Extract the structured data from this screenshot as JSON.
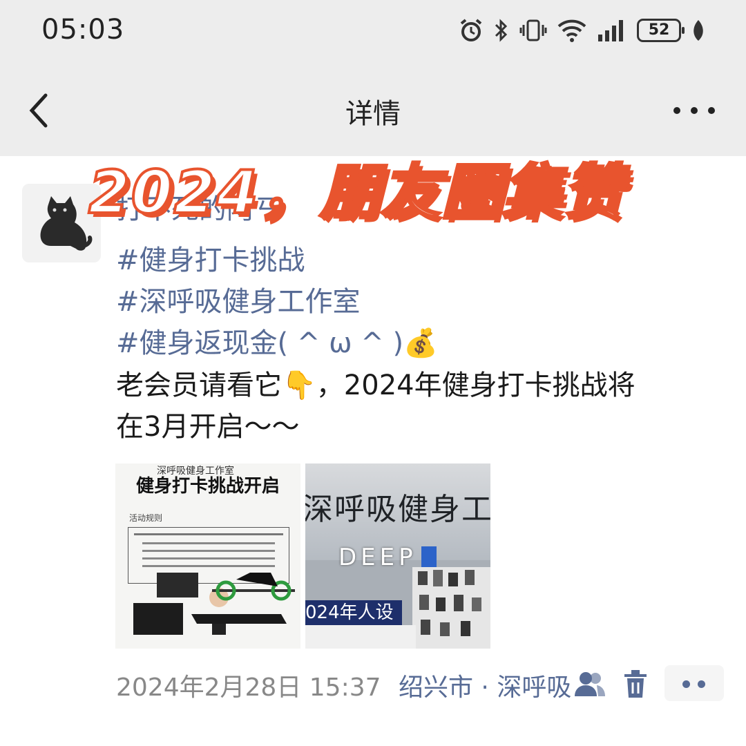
{
  "status_bar": {
    "time": "05:03",
    "battery": "52"
  },
  "nav": {
    "title": "详情"
  },
  "overlay": {
    "title": "2024，朋友圈集赞"
  },
  "post": {
    "username": "打不死的阿ㄢ",
    "tags": [
      "#健身打卡挑战",
      "#深呼吸健身工作室",
      "#健身返现金( ^ ω ^ )💰"
    ],
    "body_line1": "老会员请看它👇，2024年健身打卡挑战将",
    "body_line2": "在3月开启～～",
    "photo1": {
      "header": "深呼吸健身工作室",
      "title": "健身打卡挑战开启",
      "subtitle": "活动规则"
    },
    "photo2": {
      "sign": "深呼吸健身工",
      "brand": "DEEP",
      "banner": "024年人设"
    },
    "datetime": "2024年2月28日 15:37",
    "location": "绍兴市 · 深呼吸",
    "icons": [
      "friends-icon",
      "trash-icon",
      "comment-dots-icon"
    ]
  },
  "colors": {
    "link": "#576b95",
    "accent": "#e8542e",
    "bar": "#ededed"
  }
}
